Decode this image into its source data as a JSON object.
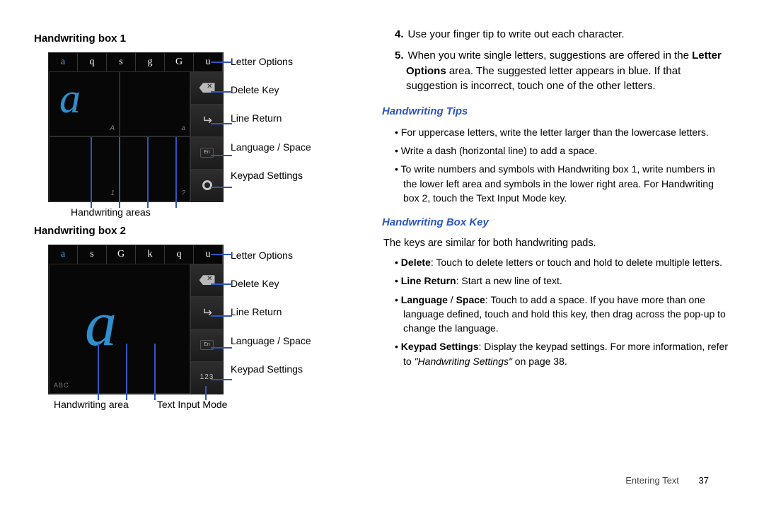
{
  "left": {
    "box1_title": "Handwriting box 1",
    "box2_title": "Handwriting box 2",
    "strip1": [
      "a",
      "q",
      "s",
      "g",
      "G",
      "u"
    ],
    "strip2": [
      "a",
      "s",
      "G",
      "k",
      "q",
      "u"
    ],
    "quad_labels": {
      "tl": "A",
      "tr": "a",
      "bl": "1",
      "br": "?"
    },
    "single_label": "ABC",
    "sp_label": "En",
    "k123": "123",
    "right_labels": [
      "Letter Options",
      "Delete Key",
      "Line Return",
      "Language / Space",
      "Keypad Settings"
    ],
    "bottom1": "Handwriting areas",
    "bottom2_a": "Handwriting area",
    "bottom2_b": "Text Input Mode"
  },
  "right": {
    "step4_num": "4.",
    "step4": "Use your finger tip to write out each character.",
    "step5_num": "5.",
    "step5_a": "When you write single letters, suggestions are offered in the ",
    "step5_b": "Letter Options",
    "step5_c": " area. The suggested letter appears in blue. If that suggestion is incorrect, touch one of the other letters.",
    "tips_h": "Handwriting Tips",
    "tips": [
      "For uppercase letters, write the letter larger than the lowercase letters.",
      "Write a dash (horizontal line) to add a space.",
      "To write numbers and symbols with Handwriting box 1, write numbers in the lower left area and symbols in the lower right area. For Handwriting box 2, touch the Text Input Mode key."
    ],
    "boxkey_h": "Handwriting Box Key",
    "boxkey_intro": "The keys are similar for both handwriting pads.",
    "k_delete_b": "Delete",
    "k_delete": ": Touch to delete letters or touch and hold to delete multiple letters.",
    "k_line_b": "Line Return",
    "k_line": ": Start a new line of text.",
    "k_lang_b": "Language",
    "k_lang_sep": " / ",
    "k_space_b": "Space",
    "k_lang": ": Touch to add a space. If you have more than one language defined, touch and hold this key, then drag across the pop-up to change the language.",
    "k_set_b": "Keypad Settings",
    "k_set_a": ": Display the keypad settings. For more information, refer to ",
    "k_set_i": "\"Handwriting Settings\"",
    "k_set_c": "  on page 38."
  },
  "footer": {
    "section": "Entering Text",
    "page": "37"
  }
}
